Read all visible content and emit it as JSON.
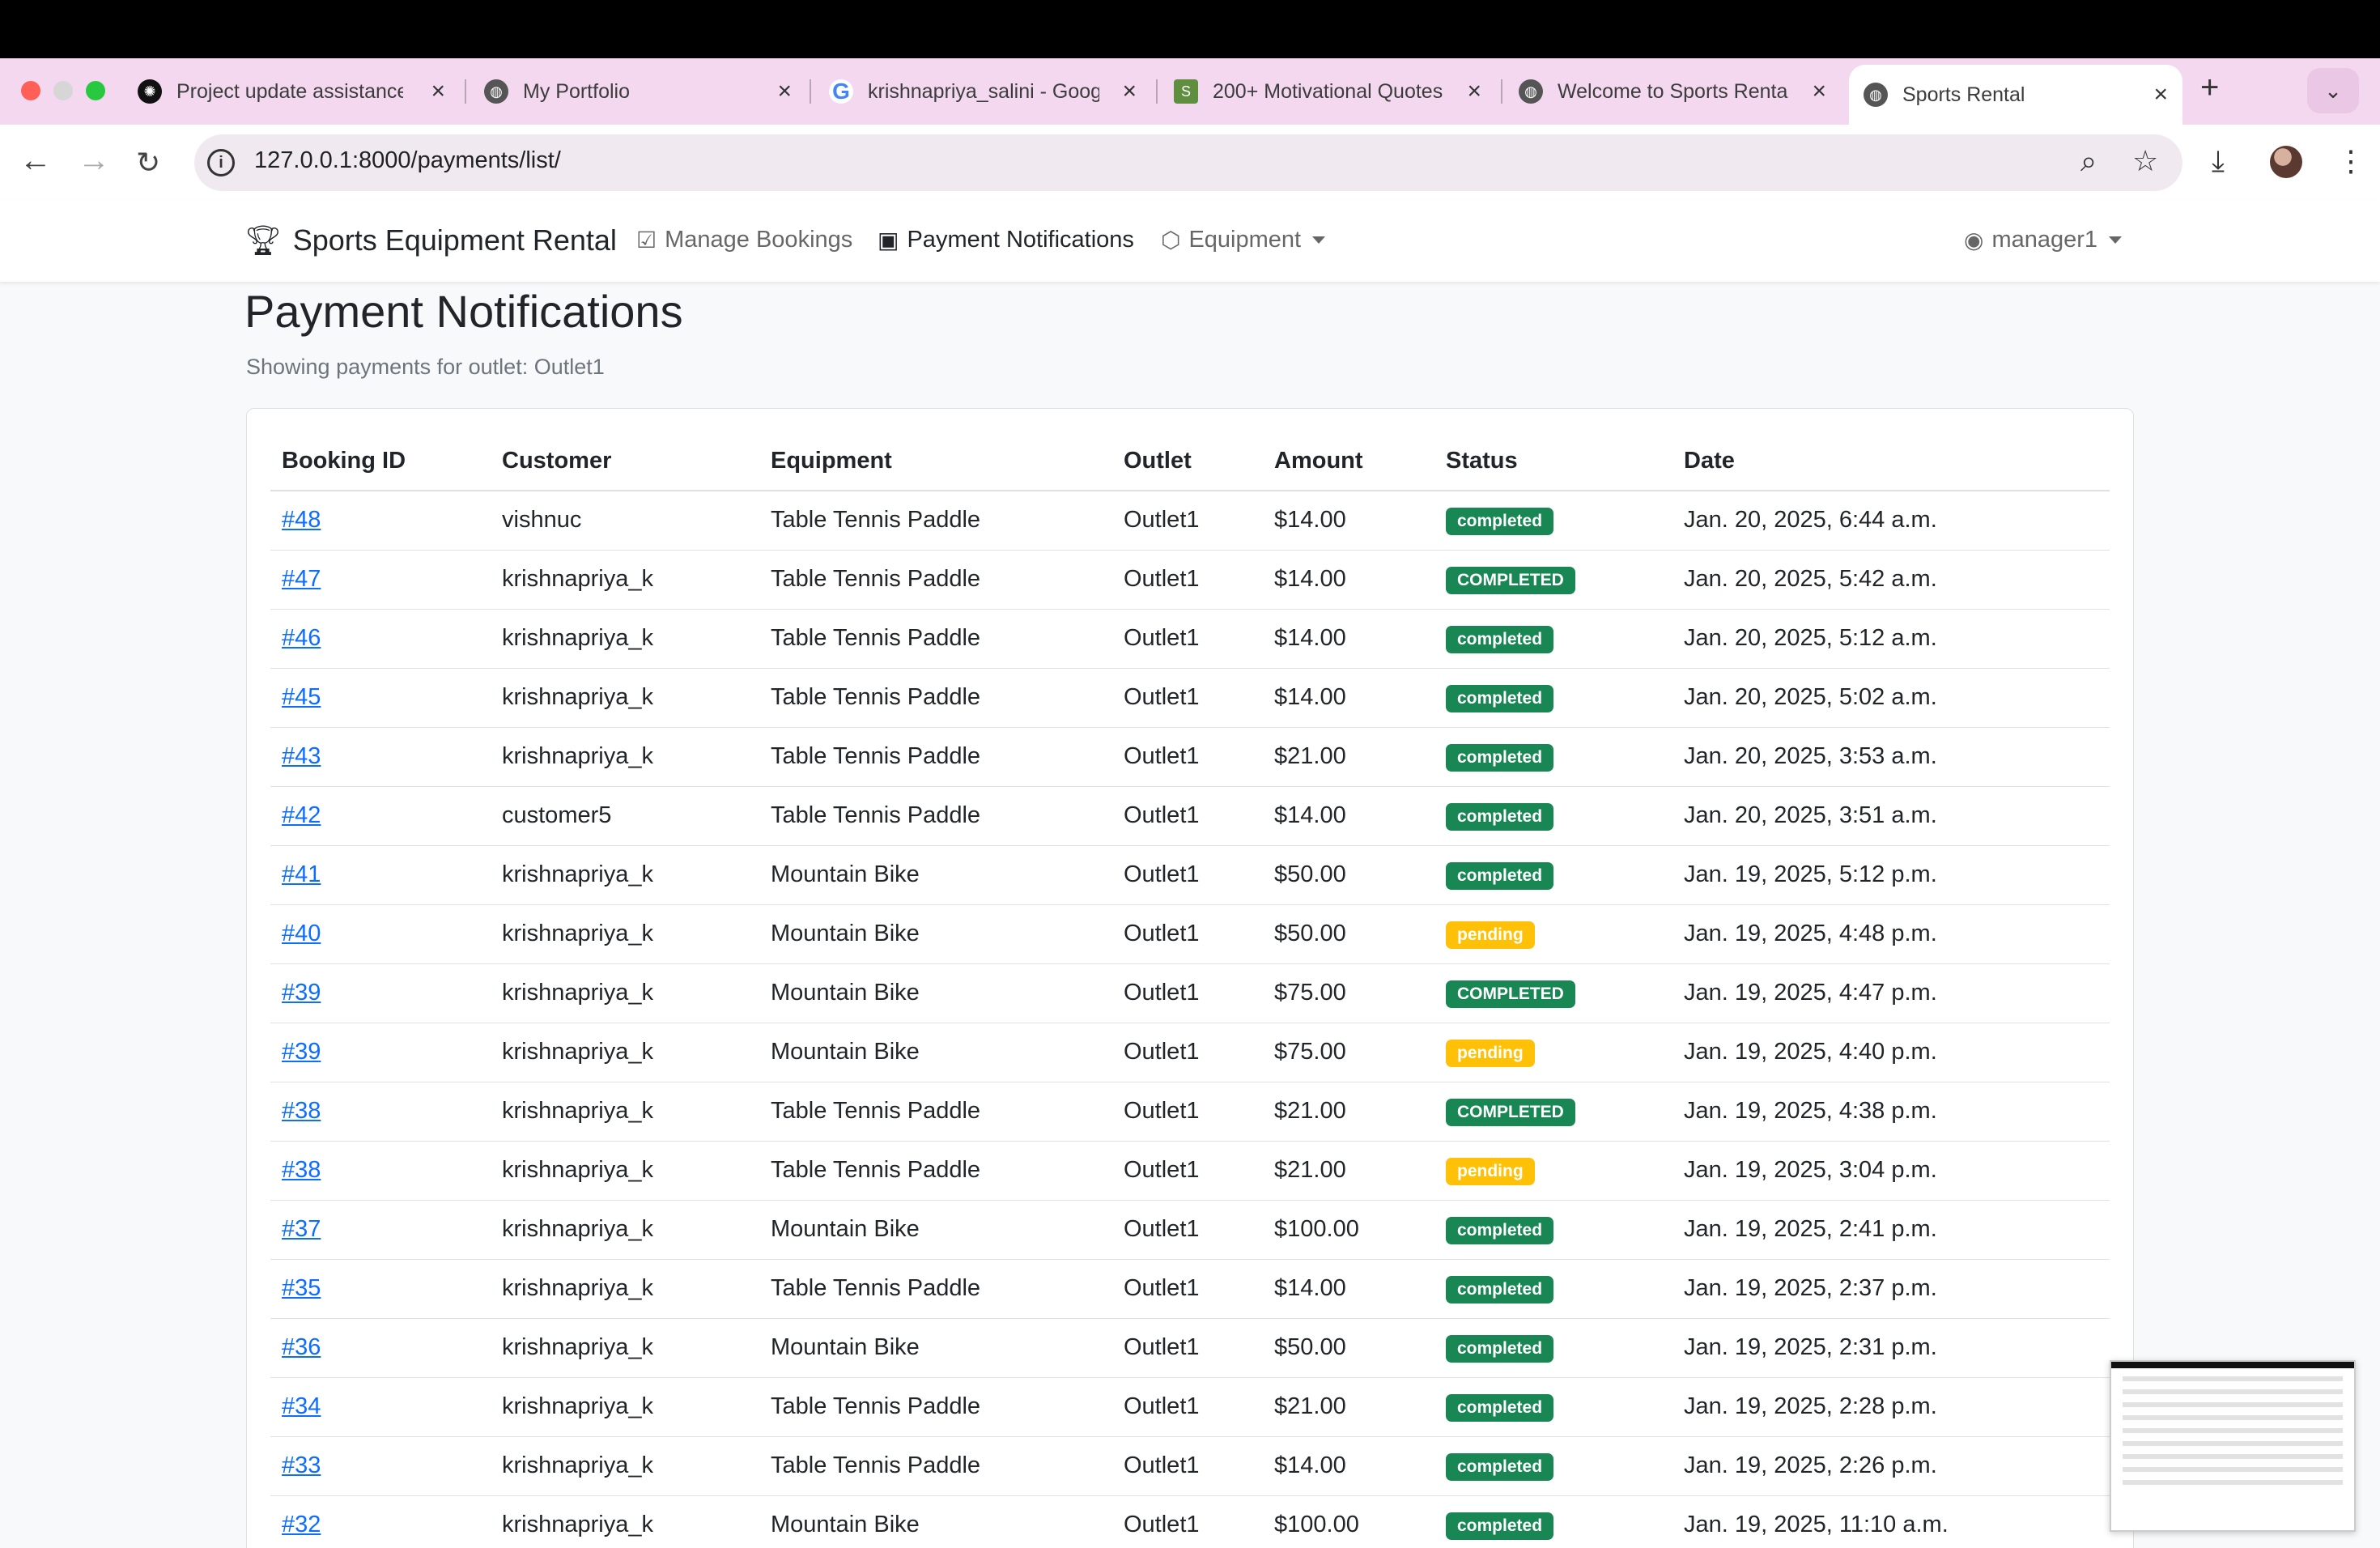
{
  "browser": {
    "tabs": [
      {
        "title": "Project update assistance",
        "favicon": "openai-icon"
      },
      {
        "title": "My Portfolio",
        "favicon": "globe-icon"
      },
      {
        "title": "krishnapriya_salini - Google Search",
        "favicon": "google-icon"
      },
      {
        "title": "200+ Motivational Quotes",
        "favicon": "shopify-icon"
      },
      {
        "title": "Welcome to Sports Rental",
        "favicon": "globe-icon"
      },
      {
        "title": "Sports Rental",
        "favicon": "globe-icon"
      }
    ],
    "url": "127.0.0.1:8000/payments/list/"
  },
  "nav": {
    "brand": "Sports Equipment Rental",
    "links": {
      "manage_bookings": "Manage Bookings",
      "payment_notifications": "Payment Notifications",
      "equipment": "Equipment"
    },
    "user": "manager1"
  },
  "page": {
    "title": "Payment Notifications",
    "subtitle": "Showing payments for outlet: Outlet1"
  },
  "table": {
    "headers": {
      "booking_id": "Booking ID",
      "customer": "Customer",
      "equipment": "Equipment",
      "outlet": "Outlet",
      "amount": "Amount",
      "status": "Status",
      "date": "Date"
    },
    "rows": [
      {
        "id": "#48",
        "customer": "vishnuc",
        "equipment": "Table Tennis Paddle",
        "outlet": "Outlet1",
        "amount": "$14.00",
        "status": "completed",
        "date": "Jan. 20, 2025, 6:44 a.m."
      },
      {
        "id": "#47",
        "customer": "krishnapriya_k",
        "equipment": "Table Tennis Paddle",
        "outlet": "Outlet1",
        "amount": "$14.00",
        "status": "COMPLETED",
        "date": "Jan. 20, 2025, 5:42 a.m."
      },
      {
        "id": "#46",
        "customer": "krishnapriya_k",
        "equipment": "Table Tennis Paddle",
        "outlet": "Outlet1",
        "amount": "$14.00",
        "status": "completed",
        "date": "Jan. 20, 2025, 5:12 a.m."
      },
      {
        "id": "#45",
        "customer": "krishnapriya_k",
        "equipment": "Table Tennis Paddle",
        "outlet": "Outlet1",
        "amount": "$14.00",
        "status": "completed",
        "date": "Jan. 20, 2025, 5:02 a.m."
      },
      {
        "id": "#43",
        "customer": "krishnapriya_k",
        "equipment": "Table Tennis Paddle",
        "outlet": "Outlet1",
        "amount": "$21.00",
        "status": "completed",
        "date": "Jan. 20, 2025, 3:53 a.m."
      },
      {
        "id": "#42",
        "customer": "customer5",
        "equipment": "Table Tennis Paddle",
        "outlet": "Outlet1",
        "amount": "$14.00",
        "status": "completed",
        "date": "Jan. 20, 2025, 3:51 a.m."
      },
      {
        "id": "#41",
        "customer": "krishnapriya_k",
        "equipment": "Mountain Bike",
        "outlet": "Outlet1",
        "amount": "$50.00",
        "status": "completed",
        "date": "Jan. 19, 2025, 5:12 p.m."
      },
      {
        "id": "#40",
        "customer": "krishnapriya_k",
        "equipment": "Mountain Bike",
        "outlet": "Outlet1",
        "amount": "$50.00",
        "status": "pending",
        "date": "Jan. 19, 2025, 4:48 p.m."
      },
      {
        "id": "#39",
        "customer": "krishnapriya_k",
        "equipment": "Mountain Bike",
        "outlet": "Outlet1",
        "amount": "$75.00",
        "status": "COMPLETED",
        "date": "Jan. 19, 2025, 4:47 p.m."
      },
      {
        "id": "#39",
        "customer": "krishnapriya_k",
        "equipment": "Mountain Bike",
        "outlet": "Outlet1",
        "amount": "$75.00",
        "status": "pending",
        "date": "Jan. 19, 2025, 4:40 p.m."
      },
      {
        "id": "#38",
        "customer": "krishnapriya_k",
        "equipment": "Table Tennis Paddle",
        "outlet": "Outlet1",
        "amount": "$21.00",
        "status": "COMPLETED",
        "date": "Jan. 19, 2025, 4:38 p.m."
      },
      {
        "id": "#38",
        "customer": "krishnapriya_k",
        "equipment": "Table Tennis Paddle",
        "outlet": "Outlet1",
        "amount": "$21.00",
        "status": "pending",
        "date": "Jan. 19, 2025, 3:04 p.m."
      },
      {
        "id": "#37",
        "customer": "krishnapriya_k",
        "equipment": "Mountain Bike",
        "outlet": "Outlet1",
        "amount": "$100.00",
        "status": "completed",
        "date": "Jan. 19, 2025, 2:41 p.m."
      },
      {
        "id": "#35",
        "customer": "krishnapriya_k",
        "equipment": "Table Tennis Paddle",
        "outlet": "Outlet1",
        "amount": "$14.00",
        "status": "completed",
        "date": "Jan. 19, 2025, 2:37 p.m."
      },
      {
        "id": "#36",
        "customer": "krishnapriya_k",
        "equipment": "Mountain Bike",
        "outlet": "Outlet1",
        "amount": "$50.00",
        "status": "completed",
        "date": "Jan. 19, 2025, 2:31 p.m."
      },
      {
        "id": "#34",
        "customer": "krishnapriya_k",
        "equipment": "Table Tennis Paddle",
        "outlet": "Outlet1",
        "amount": "$21.00",
        "status": "completed",
        "date": "Jan. 19, 2025, 2:28 p.m."
      },
      {
        "id": "#33",
        "customer": "krishnapriya_k",
        "equipment": "Table Tennis Paddle",
        "outlet": "Outlet1",
        "amount": "$14.00",
        "status": "completed",
        "date": "Jan. 19, 2025, 2:26 p.m."
      },
      {
        "id": "#32",
        "customer": "krishnapriya_k",
        "equipment": "Mountain Bike",
        "outlet": "Outlet1",
        "amount": "$100.00",
        "status": "completed",
        "date": "Jan. 19, 2025, 11:10 a.m."
      }
    ]
  },
  "colors": {
    "completed": "#198754",
    "pending": "#ffc107",
    "link": "#0d6efd",
    "tabstrip": "#f3d8ef"
  }
}
